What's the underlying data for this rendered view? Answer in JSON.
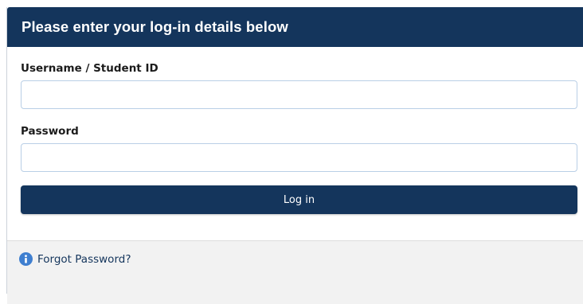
{
  "header": {
    "title": "Please enter your log-in details below"
  },
  "form": {
    "username_label": "Username / Student ID",
    "username_value": "",
    "password_label": "Password",
    "password_value": "",
    "login_button_label": "Log in"
  },
  "footer": {
    "forgot_password_label": "Forgot Password?",
    "icon": "info-icon"
  },
  "colors": {
    "brand": "#14355c",
    "input_border": "#b9cfe6",
    "footer_background": "#f2f2f2",
    "info_icon": "#3f7fd0"
  }
}
